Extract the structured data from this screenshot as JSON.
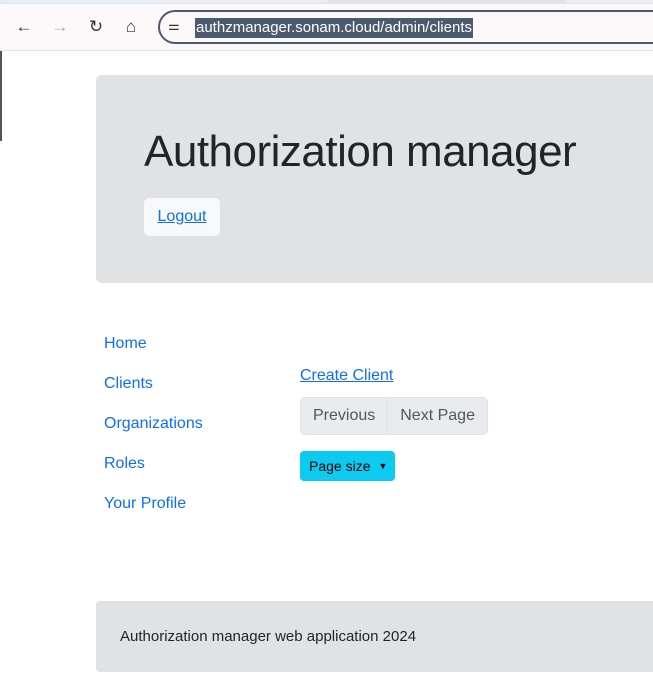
{
  "browser": {
    "url": "authzmanager.sonam.cloud/admin/clients",
    "icons": [
      "back-icon",
      "forward-icon",
      "reload-icon",
      "home-icon",
      "site-settings-icon"
    ]
  },
  "header": {
    "title": "Authorization manager",
    "logout": "Logout"
  },
  "nav": {
    "items": [
      {
        "label": "Home"
      },
      {
        "label": "Clients"
      },
      {
        "label": "Organizations"
      },
      {
        "label": "Roles"
      },
      {
        "label": "Your Profile"
      }
    ]
  },
  "main": {
    "create_client": "Create Client",
    "previous": "Previous",
    "next_page": "Next Page",
    "page_size": "Page size"
  },
  "footer": {
    "text": "Authorization manager web application 2024"
  },
  "colors": {
    "link": "#0d6efd",
    "page_size_button": "#0dcaf0",
    "jumbotron": "#e1e2e4"
  }
}
